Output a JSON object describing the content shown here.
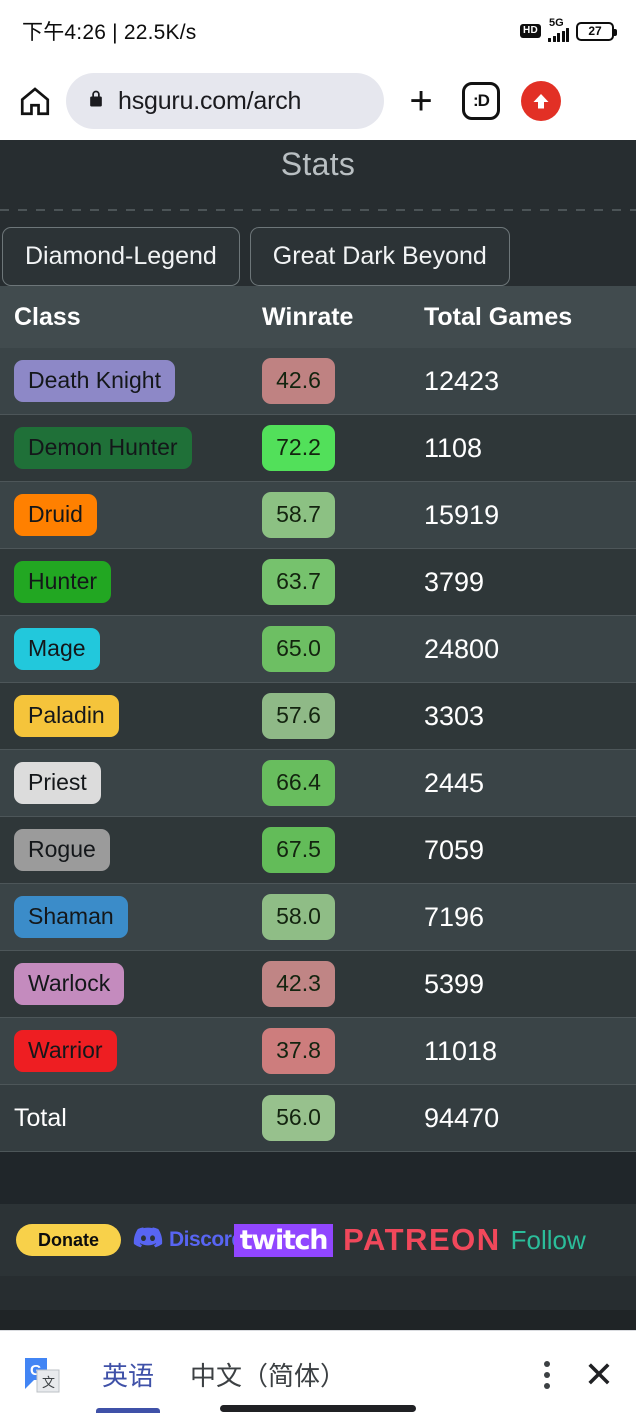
{
  "status_bar": {
    "time": "下午4:26",
    "separator": "|",
    "network_speed": "22.5K/s",
    "hd_badge": "HD",
    "network_type": "5G",
    "battery_level": "27"
  },
  "browser": {
    "home_icon": "home-icon",
    "lock_icon": "lock-icon",
    "url": "hsguru.com/arch",
    "new_tab_icon": "plus-icon",
    "tab_count_label": ":D",
    "scroll_top_icon": "up-arrow-icon"
  },
  "page": {
    "title": "Stats",
    "filters": [
      {
        "label": "Diamond-Legend"
      },
      {
        "label": "Great Dark Beyond"
      }
    ],
    "table": {
      "columns": [
        "Class",
        "Winrate",
        "Total Games"
      ],
      "rows": [
        {
          "class": "Death Knight",
          "winrate": "42.6",
          "total_games": "12423",
          "class_bg": "#8d88c7",
          "wr_bg": "#bf8282"
        },
        {
          "class": "Demon Hunter",
          "winrate": "72.2",
          "total_games": "1108",
          "class_bg": "#1f7038",
          "wr_bg": "#52e05a"
        },
        {
          "class": "Druid",
          "winrate": "58.7",
          "total_games": "15919",
          "class_bg": "#ff8000",
          "wr_bg": "#8cc183"
        },
        {
          "class": "Hunter",
          "winrate": "63.7",
          "total_games": "3799",
          "class_bg": "#22a722",
          "wr_bg": "#76c26d"
        },
        {
          "class": "Mage",
          "winrate": "65.0",
          "total_games": "24800",
          "class_bg": "#22c8dc",
          "wr_bg": "#6dbf63"
        },
        {
          "class": "Paladin",
          "winrate": "57.6",
          "total_games": "3303",
          "class_bg": "#f5c43b",
          "wr_bg": "#8fb987"
        },
        {
          "class": "Priest",
          "winrate": "66.4",
          "total_games": "2445",
          "class_bg": "#dcdcdc",
          "wr_bg": "#68bd5e"
        },
        {
          "class": "Rogue",
          "winrate": "67.5",
          "total_games": "7059",
          "class_bg": "#9b9b9b",
          "wr_bg": "#63bc59"
        },
        {
          "class": "Shaman",
          "winrate": "58.0",
          "total_games": "7196",
          "class_bg": "#3b8cc9",
          "wr_bg": "#8fbd86"
        },
        {
          "class": "Warlock",
          "winrate": "42.3",
          "total_games": "5399",
          "class_bg": "#c48bbe",
          "wr_bg": "#c08585"
        },
        {
          "class": "Warrior",
          "winrate": "37.8",
          "total_games": "11018",
          "class_bg": "#ee1e22",
          "wr_bg": "#cd7d7d"
        }
      ],
      "total_row": {
        "class": "Total",
        "winrate": "56.0",
        "total_games": "94470",
        "wr_bg": "#97c18d"
      }
    }
  },
  "footer": {
    "donate_label": "Donate",
    "discord_icon": "discord-icon",
    "discord_label": "Discord",
    "twitch_label": "twitch",
    "patreon_label": "PATREON",
    "follow_label": "Follow"
  },
  "translate_bar": {
    "logo_icon": "google-translate-icon",
    "source_language": "英语",
    "target_language": "中文（简体）",
    "menu_icon": "overflow-menu-icon",
    "close_icon": "close-icon"
  },
  "chart_data": {
    "type": "table",
    "title": "Stats",
    "columns": [
      "Class",
      "Winrate",
      "Total Games"
    ],
    "categories": [
      "Death Knight",
      "Demon Hunter",
      "Druid",
      "Hunter",
      "Mage",
      "Paladin",
      "Priest",
      "Rogue",
      "Shaman",
      "Warlock",
      "Warrior",
      "Total"
    ],
    "series": [
      {
        "name": "Winrate",
        "values": [
          42.6,
          72.2,
          58.7,
          63.7,
          65.0,
          57.6,
          66.4,
          67.5,
          58.0,
          42.3,
          37.8,
          56.0
        ]
      },
      {
        "name": "Total Games",
        "values": [
          12423,
          1108,
          15919,
          3799,
          24800,
          3303,
          2445,
          7059,
          7196,
          5399,
          11018,
          94470
        ]
      }
    ],
    "xlabel": "Class",
    "ylabel": "Winrate"
  }
}
